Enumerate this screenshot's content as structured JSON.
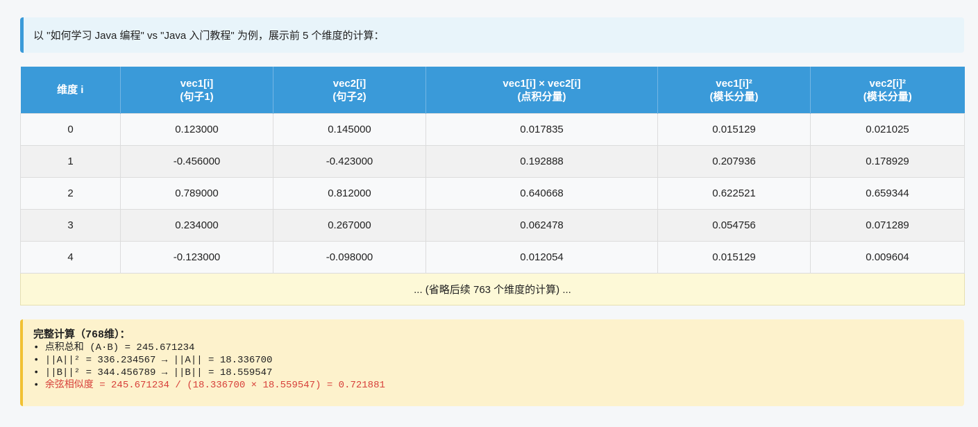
{
  "intro_text": "以 \"如何学习 Java 编程\" vs \"Java 入门教程\" 为例，展示前 5 个维度的计算：",
  "table": {
    "headers": [
      {
        "line1": "维度 i",
        "line2": ""
      },
      {
        "line1": "vec1[i]",
        "line2": "(句子1)"
      },
      {
        "line1": "vec2[i]",
        "line2": "(句子2)"
      },
      {
        "line1": "vec1[i] × vec2[i]",
        "line2": "(点积分量)"
      },
      {
        "line1": "vec1[i]²",
        "line2": "(模长分量)"
      },
      {
        "line1": "vec2[i]²",
        "line2": "(模长分量)"
      }
    ],
    "rows": [
      [
        "0",
        "0.123000",
        "0.145000",
        "0.017835",
        "0.015129",
        "0.021025"
      ],
      [
        "1",
        "-0.456000",
        "-0.423000",
        "0.192888",
        "0.207936",
        "0.178929"
      ],
      [
        "2",
        "0.789000",
        "0.812000",
        "0.640668",
        "0.622521",
        "0.659344"
      ],
      [
        "3",
        "0.234000",
        "0.267000",
        "0.062478",
        "0.054756",
        "0.071289"
      ],
      [
        "4",
        "-0.123000",
        "-0.098000",
        "0.012054",
        "0.015129",
        "0.009604"
      ]
    ],
    "omitted_text": "... (省略后续 763 个维度的计算) ..."
  },
  "summary": {
    "title": "完整计算（768维）：",
    "lines": [
      "• 点积总和 (A·B) = 245.671234",
      "• ||A||² = 336.234567 → ||A|| = 18.336700",
      "• ||B||² = 344.456789 → ||B|| = 18.559547"
    ],
    "highlight_bullet": "• ",
    "highlight_text": "余弦相似度 = 245.671234 / (18.336700 × 18.559547) = 0.721881"
  },
  "colors": {
    "header_bg": "#3a9ad9",
    "intro_bg": "#e8f4fa",
    "summary_bg": "#fdf2cc",
    "summary_border": "#f1c132",
    "highlight": "#d7403a"
  }
}
